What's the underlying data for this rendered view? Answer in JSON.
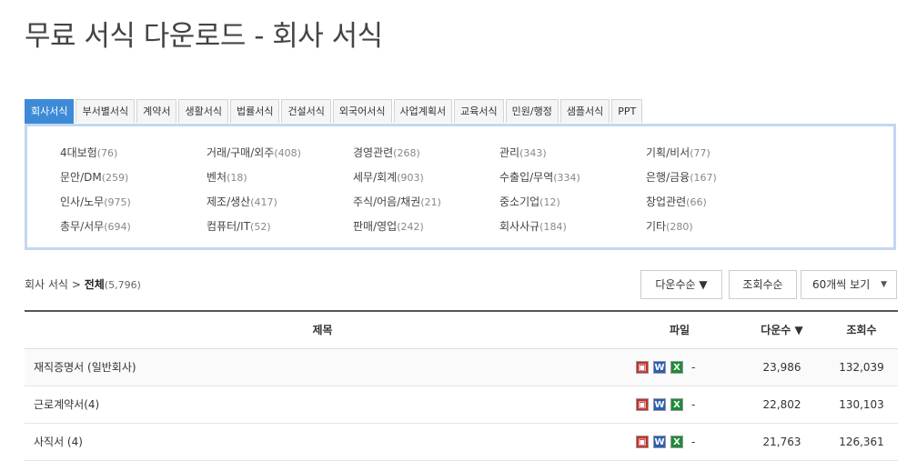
{
  "page": {
    "title": "무료 서식 다운로드 - 회사 서식"
  },
  "tabs": [
    {
      "label": "회사서식",
      "active": true
    },
    {
      "label": "부서별서식"
    },
    {
      "label": "계약서"
    },
    {
      "label": "생활서식"
    },
    {
      "label": "법률서식"
    },
    {
      "label": "건설서식"
    },
    {
      "label": "외국어서식"
    },
    {
      "label": "사업계획서"
    },
    {
      "label": "교육서식"
    },
    {
      "label": "민원/행정"
    },
    {
      "label": "샘플서식"
    },
    {
      "label": "PPT"
    }
  ],
  "categories": [
    [
      {
        "name": "4대보험",
        "count": "(76)"
      },
      {
        "name": "거래/구매/외주",
        "count": "(408)"
      },
      {
        "name": "경영관련",
        "count": "(268)"
      },
      {
        "name": "관리",
        "count": "(343)"
      },
      {
        "name": "기획/비서",
        "count": "(77)"
      }
    ],
    [
      {
        "name": "문안/DM",
        "count": "(259)"
      },
      {
        "name": "벤처",
        "count": "(18)"
      },
      {
        "name": "세무/회계",
        "count": "(903)"
      },
      {
        "name": "수출입/무역",
        "count": "(334)"
      },
      {
        "name": "은행/금융",
        "count": "(167)"
      }
    ],
    [
      {
        "name": "인사/노무",
        "count": "(975)"
      },
      {
        "name": "제조/생산",
        "count": "(417)"
      },
      {
        "name": "주식/어음/채권",
        "count": "(21)"
      },
      {
        "name": "중소기업",
        "count": "(12)"
      },
      {
        "name": "창업관련",
        "count": "(66)"
      }
    ],
    [
      {
        "name": "총무/서무",
        "count": "(694)"
      },
      {
        "name": "컴퓨터/IT",
        "count": "(52)"
      },
      {
        "name": "판매/영업",
        "count": "(242)"
      },
      {
        "name": "회사사규",
        "count": "(184)"
      },
      {
        "name": "기타",
        "count": "(280)"
      }
    ]
  ],
  "breadcrumb": {
    "parent": "회사 서식",
    "sep": ">",
    "current": "전체",
    "count": "(5,796)"
  },
  "sort": {
    "download_label": "다운수순",
    "view_label": "조회수순",
    "per_page": "60개씩 보기"
  },
  "table": {
    "headers": {
      "title": "제목",
      "file": "파일",
      "downloads": "다운수",
      "views": "조회수"
    },
    "rows": [
      {
        "title": "재직증명서 (일반회사)",
        "extra": "-",
        "downloads": "23,986",
        "views": "132,039"
      },
      {
        "title": "근로계약서(4)",
        "extra": "-",
        "downloads": "22,802",
        "views": "130,103"
      },
      {
        "title": "사직서 (4)",
        "extra": "-",
        "downloads": "21,763",
        "views": "126,361"
      }
    ]
  },
  "icons": {
    "pdf": "pdf-icon",
    "word": "word-icon",
    "excel": "excel-icon",
    "sort": "sort-down-icon",
    "dropdown": "dropdown-arrow-icon"
  }
}
